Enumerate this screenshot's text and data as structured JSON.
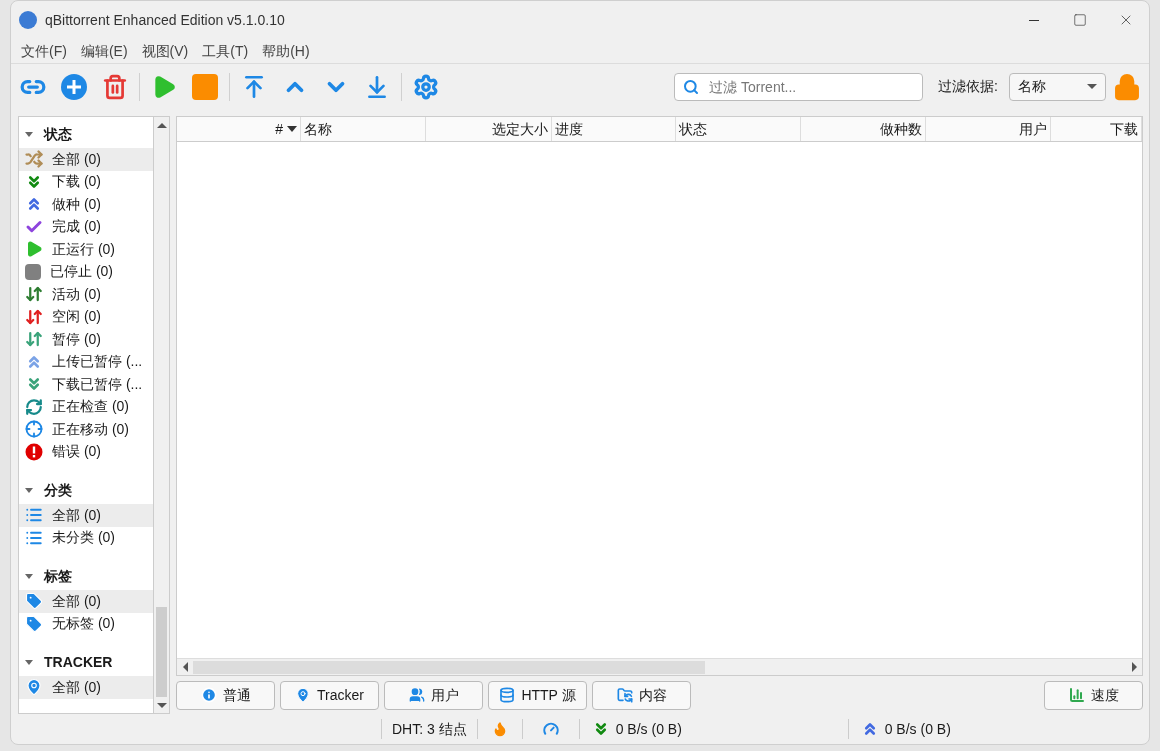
{
  "window": {
    "title": "qBittorrent Enhanced Edition v5.1.0.10"
  },
  "menu": [
    "文件(F)",
    "编辑(E)",
    "视图(V)",
    "工具(T)",
    "帮助(H)"
  ],
  "toolbar": {
    "buttons": [
      {
        "kind": "link"
      },
      {
        "kind": "add"
      },
      {
        "kind": "delete"
      },
      {
        "kind": "sep"
      },
      {
        "kind": "start"
      },
      {
        "kind": "stop"
      },
      {
        "kind": "sep"
      },
      {
        "kind": "top"
      },
      {
        "kind": "up"
      },
      {
        "kind": "down"
      },
      {
        "kind": "bottom"
      },
      {
        "kind": "sep"
      },
      {
        "kind": "options"
      }
    ],
    "search": {
      "placeholder": "过滤 Torrent..."
    },
    "filter_label": "过滤依据:",
    "filter_by": "名称"
  },
  "sidebar": [
    {
      "title": "状态",
      "expanded": true,
      "items": [
        {
          "label": "全部 (0)",
          "kind": "shuffle",
          "selected": true
        },
        {
          "label": "下载 (0)",
          "kind": "downloading",
          "selected": false
        },
        {
          "label": "做种 (0)",
          "kind": "seeding",
          "selected": false
        },
        {
          "label": "完成 (0)",
          "kind": "completed",
          "selected": false
        },
        {
          "label": "正运行 (0)",
          "kind": "running",
          "selected": false
        },
        {
          "label": "已停止 (0)",
          "kind": "stopped",
          "selected": false
        },
        {
          "label": "活动 (0)",
          "kind": "active",
          "selected": false
        },
        {
          "label": "空闲 (0)",
          "kind": "inactive",
          "selected": false
        },
        {
          "label": "暂停 (0)",
          "kind": "stalled",
          "selected": false
        },
        {
          "label": "上传已暂停 (...",
          "kind": "up_paused",
          "selected": false
        },
        {
          "label": "下载已暂停 (...",
          "kind": "down_paused",
          "selected": false
        },
        {
          "label": "正在检查 (0)",
          "kind": "checking",
          "selected": false
        },
        {
          "label": "正在移动 (0)",
          "kind": "moving",
          "selected": false
        },
        {
          "label": "错误 (0)",
          "kind": "error",
          "selected": false
        }
      ]
    },
    {
      "title": "分类",
      "expanded": true,
      "items": [
        {
          "label": "全部 (0)",
          "kind": "list",
          "selected": true
        },
        {
          "label": "未分类 (0)",
          "kind": "list",
          "selected": false
        }
      ]
    },
    {
      "title": "标签",
      "expanded": true,
      "items": [
        {
          "label": "全部 (0)",
          "kind": "tag",
          "selected": true
        },
        {
          "label": "无标签 (0)",
          "kind": "tag",
          "selected": false
        }
      ]
    },
    {
      "title": "TRACKER",
      "expanded": true,
      "items": [
        {
          "label": "全部 (0)",
          "kind": "pin",
          "selected": true
        }
      ]
    }
  ],
  "table": {
    "columns": [
      {
        "label": "#",
        "sorted": true
      },
      {
        "label": "名称",
        "sorted": false
      },
      {
        "label": "选定大小",
        "sorted": false
      },
      {
        "label": "进度",
        "sorted": false
      },
      {
        "label": "状态",
        "sorted": false
      },
      {
        "label": "做种数",
        "sorted": false
      },
      {
        "label": "用户",
        "sorted": false
      },
      {
        "label": "下载",
        "sorted": false
      }
    ]
  },
  "tabs": [
    {
      "label": "普通",
      "kind": "info"
    },
    {
      "label": "Tracker",
      "kind": "pin"
    },
    {
      "label": "用户",
      "kind": "users"
    },
    {
      "label": "HTTP 源",
      "kind": "db"
    },
    {
      "label": "内容",
      "kind": "folder"
    }
  ],
  "speed_button": "速度",
  "status_bar": {
    "dht": "DHT:  3 结点",
    "download": "0 B/s (0 B)",
    "upload": "0 B/s (0 B)"
  }
}
